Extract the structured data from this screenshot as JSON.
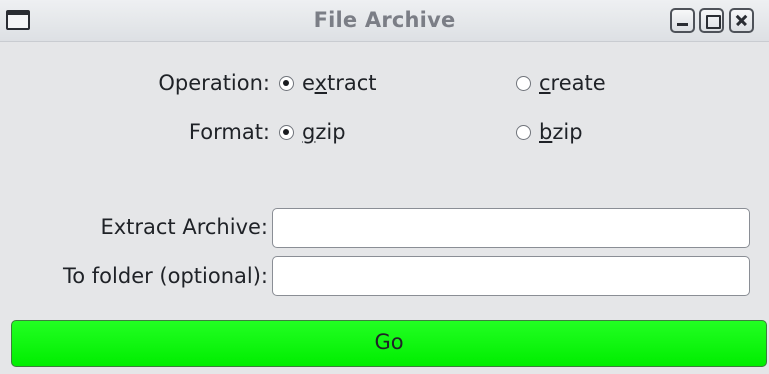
{
  "window": {
    "title": "File Archive",
    "buttons": [
      "minimize-icon",
      "maximize-icon",
      "close-icon"
    ]
  },
  "operation": {
    "label": "Operation:",
    "options": [
      {
        "before": "e",
        "mnemonic": "x",
        "after": "tract",
        "selected": true
      },
      {
        "before": "",
        "mnemonic": "c",
        "after": "reate",
        "selected": false
      }
    ]
  },
  "format": {
    "label": "Format:",
    "options": [
      {
        "before": "",
        "mnemonic": "g",
        "after": "zip",
        "selected": true
      },
      {
        "before": "",
        "mnemonic": "b",
        "after": "zip",
        "selected": false
      }
    ]
  },
  "fields": {
    "archive_label": "Extract Archive:",
    "archive_value": "",
    "folder_label": "To folder (optional):",
    "folder_value": ""
  },
  "go_button": {
    "label": "Go",
    "color": "#00ee00"
  }
}
